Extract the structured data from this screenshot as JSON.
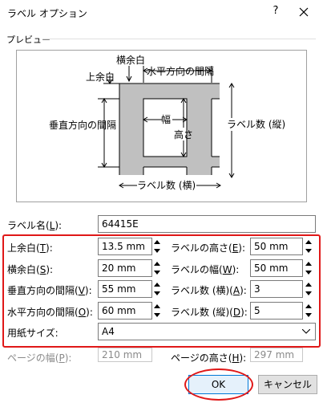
{
  "window": {
    "title": "ラベル オプション",
    "help": "?",
    "close": "✕"
  },
  "preview": {
    "group_label": "プレビュー",
    "labels": {
      "side_margin": "横余白",
      "top_margin": "上余白",
      "horizontal_pitch": "水平方向の間隔",
      "vertical_pitch": "垂直方向の間隔",
      "width": "幅",
      "height": "高さ",
      "number_down": "ラベル数 (縦)",
      "number_across": "ラベル数 (横)"
    }
  },
  "label_name": {
    "label": "ラベル名(",
    "key": "L",
    "suffix": "):",
    "value": "64415E"
  },
  "fields": {
    "top_margin": {
      "label": "上余白(",
      "key": "T",
      "suffix": "):",
      "value": "13.5 mm"
    },
    "side_margin": {
      "label": "横余白(",
      "key": "S",
      "suffix": "):",
      "value": "20 mm"
    },
    "vertical_pitch": {
      "label": "垂直方向の間隔(",
      "key": "V",
      "suffix": "):",
      "value": "55 mm"
    },
    "horizontal_pitch": {
      "label": "水平方向の間隔(",
      "key": "O",
      "suffix": "):",
      "value": "60 mm"
    },
    "label_height": {
      "label": "ラベルの高さ(",
      "key": "E",
      "suffix": "):",
      "value": "50 mm"
    },
    "label_width": {
      "label": "ラベルの幅(",
      "key": "W",
      "suffix": "):",
      "value": "50 mm"
    },
    "number_across": {
      "label": "ラベル数 (横)(",
      "key": "A",
      "suffix": "):",
      "value": "3"
    },
    "number_down": {
      "label": "ラベル数 (縦)(",
      "key": "D",
      "suffix": "):",
      "value": "5"
    },
    "page_size": {
      "label": "用紙サイズ:",
      "value": "A4"
    },
    "page_width": {
      "label": "ページの幅(",
      "key": "P",
      "suffix": "):",
      "value": "210 mm"
    },
    "page_height": {
      "label": "ページの高さ(",
      "key": "H",
      "suffix": "):",
      "value": "297 mm"
    }
  },
  "buttons": {
    "ok": "OK",
    "cancel": "キャンセル"
  },
  "colors": {
    "highlight": "#e01818",
    "label_fill": "#c0c0c0",
    "default_button_border": "#0078d7"
  }
}
